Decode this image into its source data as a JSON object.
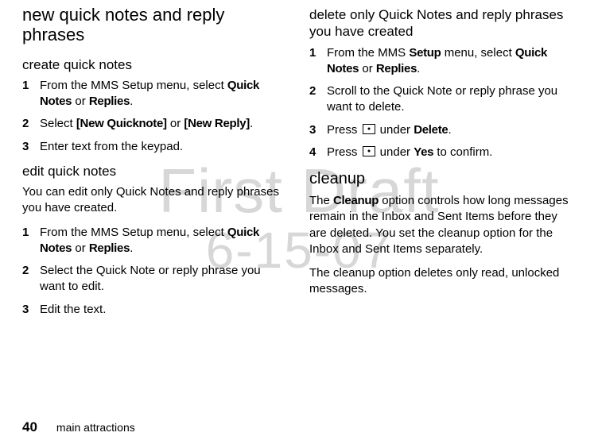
{
  "watermark": {
    "line1": "First Draft",
    "line2": "6-15-07"
  },
  "left": {
    "heading": "new quick notes and reply phrases",
    "section1": {
      "title": "create quick notes",
      "steps": [
        {
          "pre": "From the MMS Setup menu, select ",
          "b1": "Quick Notes",
          "mid": " or ",
          "b2": "Replies",
          "post": "."
        },
        {
          "pre": "Select ",
          "b1": "[New Quicknote]",
          "mid": " or ",
          "b2": "[New Reply]",
          "post": "."
        },
        {
          "pre": "Enter text from the keypad.",
          "b1": "",
          "mid": "",
          "b2": "",
          "post": ""
        }
      ]
    },
    "section2": {
      "title": "edit quick notes",
      "intro": "You can edit only Quick Notes and reply phrases you have created.",
      "steps": [
        {
          "pre": "From the MMS Setup menu, select ",
          "b1": "Quick Notes",
          "mid": " or ",
          "b2": "Replies",
          "post": "."
        },
        {
          "pre": "Select the Quick Note or reply phrase you want to edit.",
          "b1": "",
          "mid": "",
          "b2": "",
          "post": ""
        },
        {
          "pre": "Edit the text.",
          "b1": "",
          "mid": "",
          "b2": "",
          "post": ""
        }
      ]
    }
  },
  "right": {
    "heading": "delete only Quick Notes and reply phrases you have created",
    "steps": [
      {
        "pre": "From the MMS ",
        "b0": "Setup",
        "preb": " menu, select ",
        "b1": "Quick Notes",
        "mid": " or ",
        "b2": "Replies",
        "post": "."
      },
      {
        "pre": "Scroll to the Quick Note or reply phrase you want to delete.",
        "b0": "",
        "preb": "",
        "b1": "",
        "mid": "",
        "b2": "",
        "post": ""
      },
      {
        "pre": "Press ",
        "key": true,
        "aft": " under ",
        "b1": "Delete",
        "post": "."
      },
      {
        "pre": "Press ",
        "key": true,
        "aft": " under ",
        "b1": "Yes",
        "post": " to confirm."
      }
    ],
    "cleanup": {
      "title": "cleanup",
      "para1_pre": "The ",
      "para1_b": "Cleanup",
      "para1_post": " option controls how long messages remain in the Inbox and Sent Items before they are deleted. You set the cleanup option for the Inbox and Sent Items separately.",
      "para2": "The cleanup option deletes only read, unlocked messages."
    }
  },
  "footer": {
    "page": "40",
    "section": "main attractions"
  }
}
